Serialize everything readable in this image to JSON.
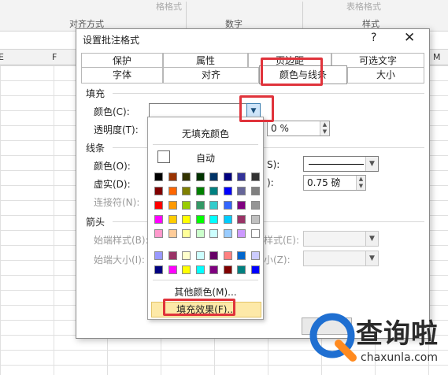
{
  "ribbon": {
    "group_align": "对齐方式",
    "group_number": "数字",
    "group_style": "样式",
    "faded_1": "格格式",
    "faded_2": "表格格式"
  },
  "grid": {
    "col_e": "E",
    "col_f": "F",
    "col_m": "M"
  },
  "dialog": {
    "title": "设置批注格式",
    "help": "?",
    "close": "✕",
    "tabs_row1": [
      "保护",
      "属性",
      "页边距",
      "可选文字"
    ],
    "tabs_row2": [
      "字体",
      "对齐",
      "颜色与线条",
      "大小"
    ],
    "active_tab": "颜色与线条",
    "fill": {
      "section": "填充",
      "color_label": "颜色(C):",
      "transparency_label": "透明度(T):",
      "transparency_value": "0 %"
    },
    "line": {
      "section": "线条",
      "color_label": "颜色(O):",
      "dash_label": "虚实(D):",
      "connector_label": "连接符(N):",
      "style_label_tail": "S):",
      "weight_label_tail": "):",
      "weight_value": "0.75 磅"
    },
    "arrows": {
      "section": "箭头",
      "begin_style_label": "始端样式(B):",
      "begin_size_label": "始端大小(I):",
      "end_style_tail": "样式(E):",
      "end_size_tail": "小(Z):"
    }
  },
  "color_panel": {
    "no_fill": "无填充颜色",
    "automatic": "自动",
    "more_colors": "其他颜色(M)...",
    "fill_effects": "填充效果(F)...",
    "palette": [
      [
        "#000000",
        "#993300",
        "#333300",
        "#003300",
        "#003366",
        "#000080",
        "#333399",
        "#333333"
      ],
      [
        "#800000",
        "#ff6600",
        "#808000",
        "#008000",
        "#008080",
        "#0000ff",
        "#666699",
        "#808080"
      ],
      [
        "#ff0000",
        "#ff9900",
        "#99cc00",
        "#339966",
        "#33cccc",
        "#3366ff",
        "#800080",
        "#969696"
      ],
      [
        "#ff00ff",
        "#ffcc00",
        "#ffff00",
        "#00ff00",
        "#00ffff",
        "#00ccff",
        "#993366",
        "#c0c0c0"
      ],
      [
        "#ff99cc",
        "#ffcc99",
        "#ffff99",
        "#ccffcc",
        "#ccffff",
        "#99ccff",
        "#cc99ff",
        "#ffffff"
      ],
      [
        "#9999ff",
        "#993366",
        "#ffffcc",
        "#ccffff",
        "#660066",
        "#ff8080",
        "#0066cc",
        "#ccccff"
      ],
      [
        "#000080",
        "#ff00ff",
        "#ffff00",
        "#00ffff",
        "#800080",
        "#800000",
        "#008080",
        "#0000ff"
      ]
    ]
  },
  "watermark": {
    "brand": "查询啦",
    "domain": "chaxunla.com"
  }
}
